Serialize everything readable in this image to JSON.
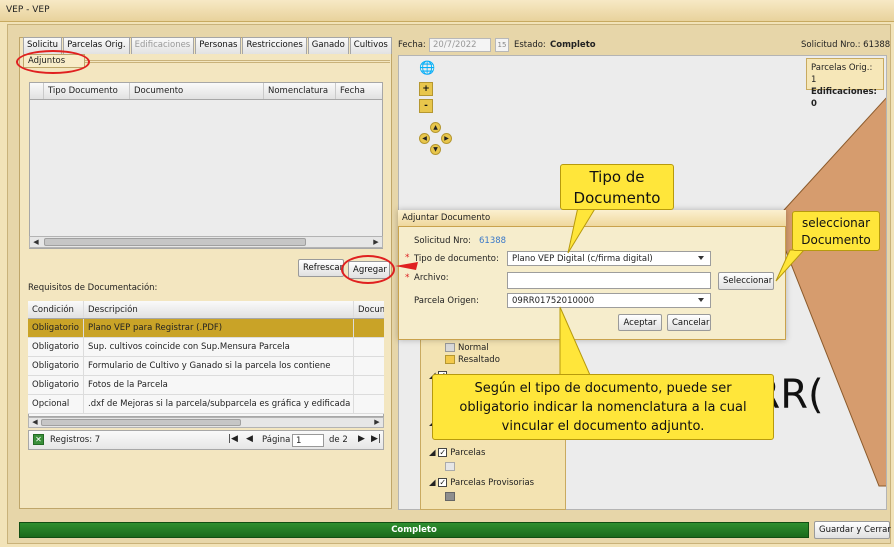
{
  "window": {
    "title": "VEP - VEP"
  },
  "tabs": [
    {
      "label": "Solicitu",
      "disabled": false
    },
    {
      "label": "Parcelas Orig.",
      "disabled": false
    },
    {
      "label": "Edificaciones",
      "disabled": true
    },
    {
      "label": "Personas",
      "disabled": false
    },
    {
      "label": "Restricciones",
      "disabled": false
    },
    {
      "label": "Ganado",
      "disabled": false
    },
    {
      "label": "Cultivos",
      "disabled": false
    }
  ],
  "subtab": {
    "label": "Adjuntos"
  },
  "adjuntos_grid": {
    "columns": [
      "Tipo Documento",
      "Documento",
      "Nomenclatura",
      "Fecha"
    ],
    "rows": []
  },
  "buttons": {
    "refrescar": "Refrescar",
    "agregar": "Agregar",
    "guardar": "Guardar y Cerrar",
    "aceptar": "Aceptar",
    "cancelar": "Cancelar",
    "seleccionar": "Seleccionar"
  },
  "requisitos": {
    "label": "Requisitos de Documentación:",
    "columns": [
      "Condición",
      "Descripción",
      "Docum"
    ],
    "rows": [
      {
        "condicion": "Obligatorio",
        "descripcion": "Plano VEP para Registrar (.PDF)",
        "docum": "",
        "selected": true
      },
      {
        "condicion": "Obligatorio",
        "descripcion": "Sup. cultivos coincide con Sup.Mensura Parcela",
        "docum": "",
        "selected": false
      },
      {
        "condicion": "Obligatorio",
        "descripcion": "Formulario de Cultivo y Ganado si la parcela los contiene",
        "docum": "",
        "selected": false
      },
      {
        "condicion": "Obligatorio",
        "descripcion": "Fotos de la Parcela",
        "docum": "",
        "selected": false
      },
      {
        "condicion": "Opcional",
        "descripcion": ".dxf de Mejoras si la parcela/subparcela es gráfica y edificada",
        "docum": "",
        "selected": false
      }
    ]
  },
  "pager": {
    "registros": "Registros: 7",
    "pagina_label": "Página",
    "pagina_value": "1",
    "de": "de 2"
  },
  "header": {
    "fecha_label": "Fecha:",
    "fecha_value": "20/7/2022",
    "cal": "15",
    "estado_label": "Estado:",
    "estado_value": "Completo",
    "solicitud": "Solicitud Nro.: 61388"
  },
  "counts": {
    "parcelas": "Parcelas Orig.: 1",
    "edificaciones": "Edificaciones: 0"
  },
  "map": {
    "big_text": "9RR("
  },
  "layers": {
    "normal": "Normal",
    "resaltado": "Resaltado",
    "parcelas": "Parcelas",
    "provisorias": "Parcelas Provisorias"
  },
  "dialog": {
    "title": "Adjuntar Documento",
    "solicitud_label": "Solicitud Nro:",
    "solicitud_value": "61388",
    "tipo_label": "Tipo de documento:",
    "tipo_value": "Plano VEP Digital (c/firma digital)",
    "archivo_label": "Archivo:",
    "archivo_value": "",
    "parcela_label": "Parcela Origen:",
    "parcela_value": "09RR01752010000"
  },
  "callouts": {
    "tipo": "Tipo de Documento",
    "seleccionar": "seleccionar Documento",
    "info": "Según el tipo de documento, puede ser obligatorio indicar la nomenclatura a la cual vincular el documento adjunto."
  },
  "footer": {
    "status": "Completo"
  },
  "colors": {
    "selected_row": "#c9a327",
    "callout": "#ffe63a",
    "footer": "#1f7a1f",
    "accent_link": "#3a78c8"
  }
}
